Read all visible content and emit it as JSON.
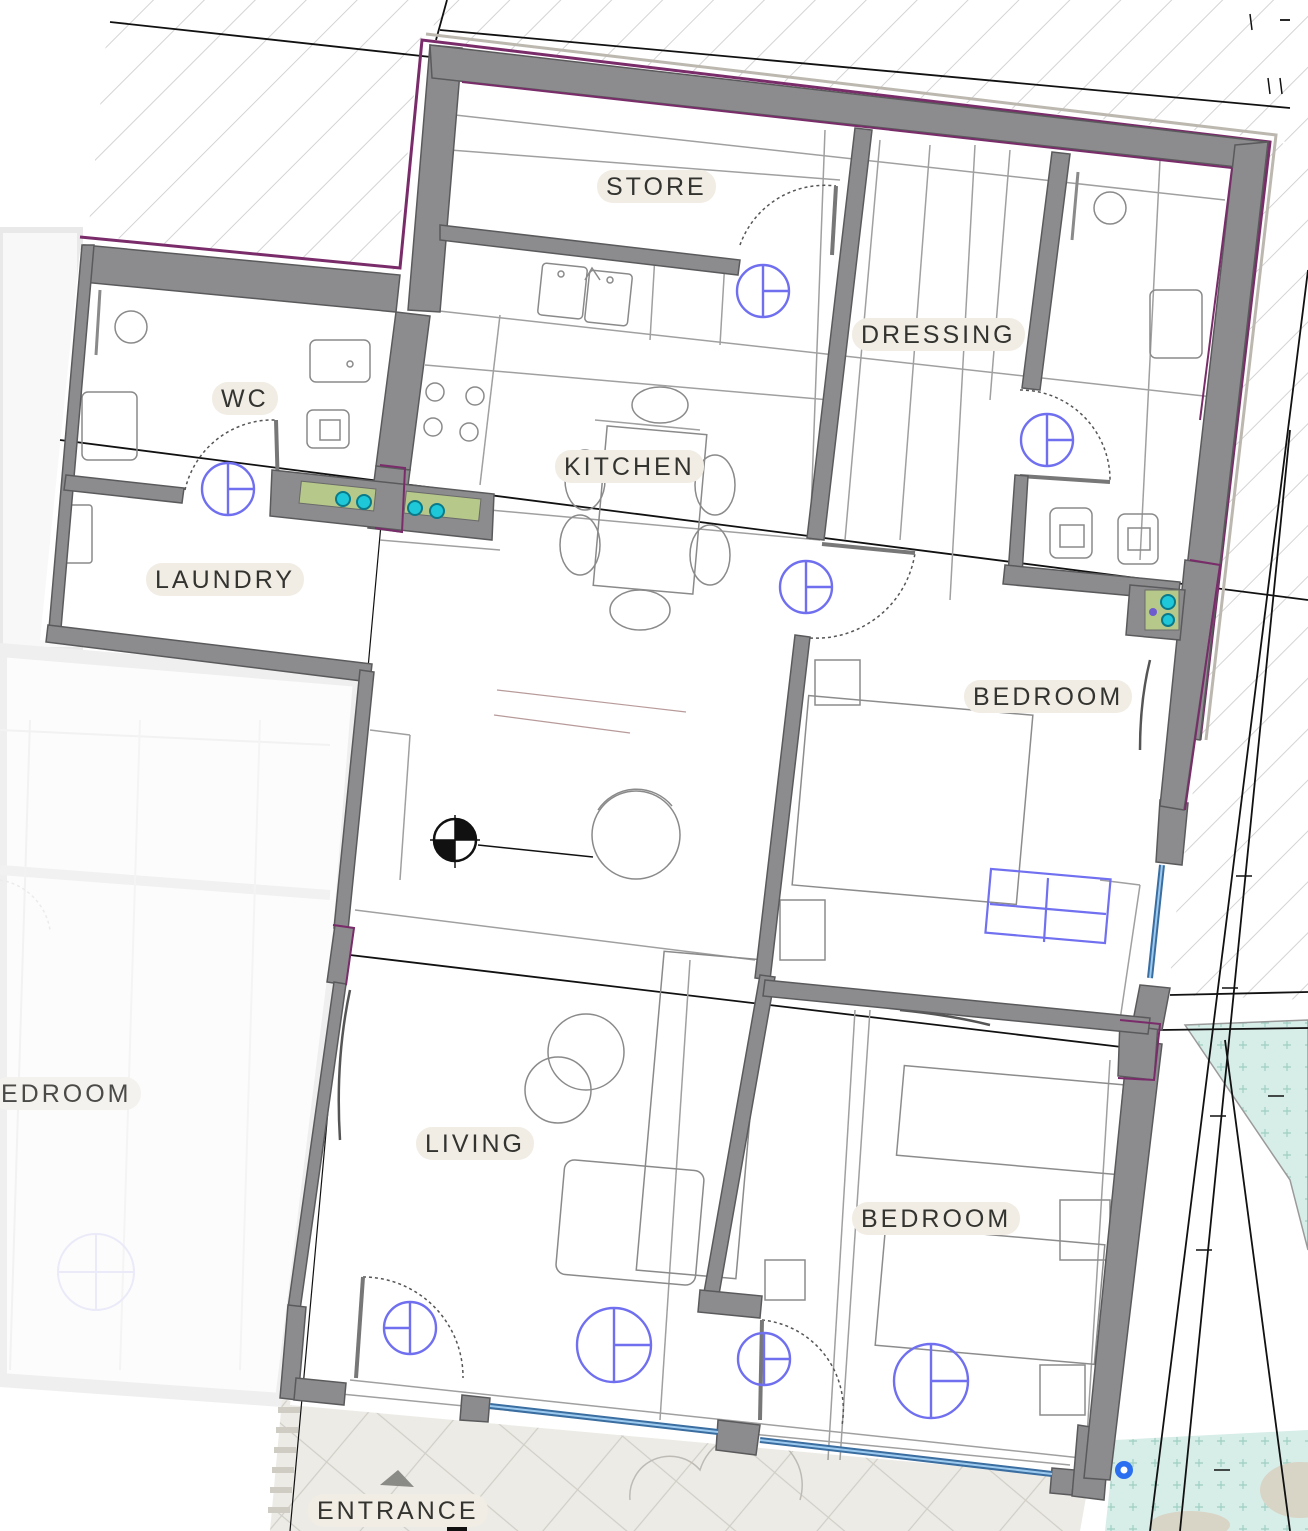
{
  "floor_plan": {
    "rooms": [
      {
        "id": "store",
        "label": "STORE"
      },
      {
        "id": "dressing",
        "label": "DRESSING"
      },
      {
        "id": "wc",
        "label": "WC"
      },
      {
        "id": "kitchen",
        "label": "KITCHEN"
      },
      {
        "id": "laundry",
        "label": "LAUNDRY"
      },
      {
        "id": "bedroom-1",
        "label": "BEDROOM"
      },
      {
        "id": "bedroom-neighbour",
        "label": "EDROOM"
      },
      {
        "id": "living",
        "label": "LIVING"
      },
      {
        "id": "bedroom-2",
        "label": "BEDROOM"
      },
      {
        "id": "entrance",
        "label": "ENTRANCE"
      }
    ],
    "colors": {
      "wall": "#8c8c8e",
      "wall_edge": "#5a5a5c",
      "boundary": "#7a2c6a",
      "light_fixture": "#6f6ff0",
      "hatch": "#d2d2d2",
      "label_background": "#f1ede4",
      "grid_line": "#111111",
      "window_glass": "#4a8fd4",
      "landscape_fill": "#d4ece6"
    },
    "icons": [
      "light-fixture-icon",
      "section-marker-icon",
      "location-pin-icon",
      "stair-arrow-icon"
    ]
  }
}
